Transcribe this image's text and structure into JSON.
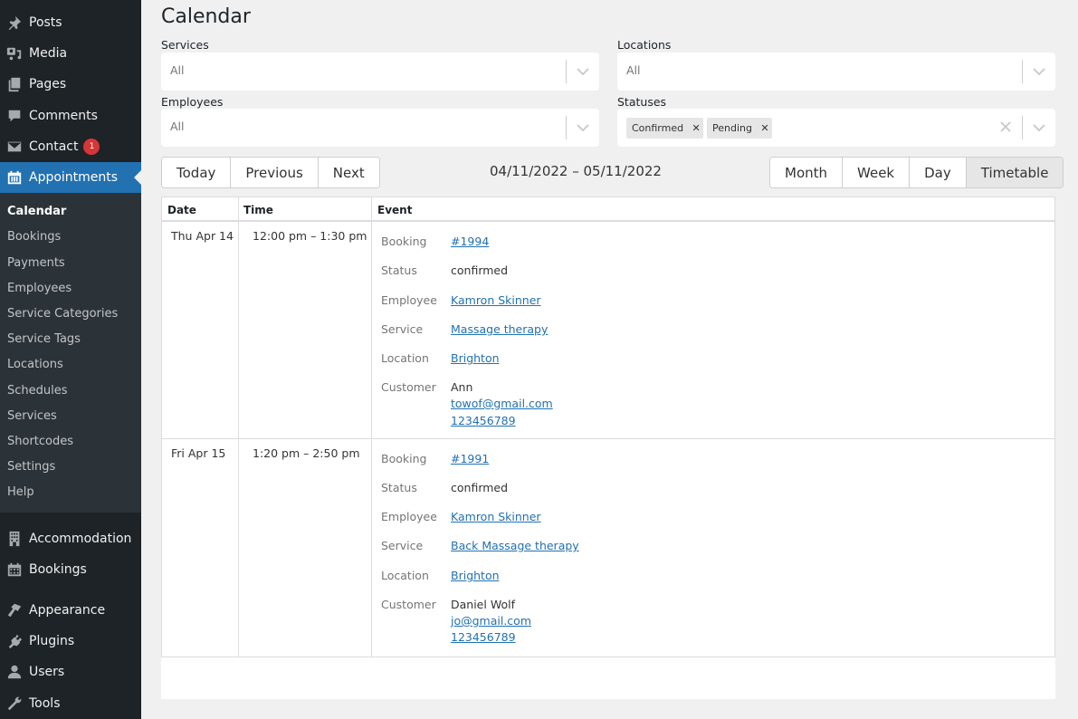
{
  "sidebar": {
    "top_items": [
      {
        "label": "Posts",
        "icon": "pin-icon"
      },
      {
        "label": "Media",
        "icon": "media-icon"
      },
      {
        "label": "Pages",
        "icon": "pages-icon"
      },
      {
        "label": "Comments",
        "icon": "comment-icon"
      },
      {
        "label": "Contact",
        "icon": "envelope-icon",
        "badge": "1"
      },
      {
        "label": "Appointments",
        "icon": "calendar-icon",
        "active": true
      }
    ],
    "submenu": [
      "Calendar",
      "Bookings",
      "Payments",
      "Employees",
      "Service Categories",
      "Service Tags",
      "Locations",
      "Schedules",
      "Services",
      "Shortcodes",
      "Settings",
      "Help"
    ],
    "submenu_current": "Calendar",
    "bottom_items": [
      {
        "label": "Accommodation",
        "icon": "building-icon"
      },
      {
        "label": "Bookings",
        "icon": "calendar-grid-icon"
      },
      {
        "label": "Appearance",
        "icon": "brush-icon"
      },
      {
        "label": "Plugins",
        "icon": "plug-icon"
      },
      {
        "label": "Users",
        "icon": "user-icon"
      },
      {
        "label": "Tools",
        "icon": "wrench-icon"
      }
    ]
  },
  "page": {
    "title": "Calendar"
  },
  "filters": {
    "services": {
      "label": "Services",
      "value": "All"
    },
    "locations": {
      "label": "Locations",
      "value": "All"
    },
    "employees": {
      "label": "Employees",
      "value": "All"
    },
    "statuses": {
      "label": "Statuses",
      "tags": [
        "Confirmed",
        "Pending"
      ]
    }
  },
  "toolbar": {
    "nav": [
      "Today",
      "Previous",
      "Next"
    ],
    "date_range": "04/11/2022 – 05/11/2022",
    "views": [
      "Month",
      "Week",
      "Day",
      "Timetable"
    ],
    "active_view": "Timetable"
  },
  "table": {
    "headers": [
      "Date",
      "Time",
      "Event"
    ],
    "field_labels": {
      "booking": "Booking",
      "status": "Status",
      "employee": "Employee",
      "service": "Service",
      "location": "Location",
      "customer": "Customer"
    },
    "rows": [
      {
        "date": "Thu Apr 14",
        "time": "12:00 pm – 1:30 pm",
        "booking": "#1994",
        "status": "confirmed",
        "employee": "Kamron Skinner",
        "service": "Massage therapy",
        "location": "Brighton",
        "customer_name": "Ann",
        "customer_email": "towof@gmail.com",
        "customer_phone": "123456789"
      },
      {
        "date": "Fri Apr 15",
        "time": "1:20 pm – 2:50 pm",
        "booking": "#1991",
        "status": "confirmed",
        "employee": "Kamron Skinner",
        "service": "Back Massage therapy",
        "location": "Brighton",
        "customer_name": "Daniel Wolf",
        "customer_email": "jo@gmail.com",
        "customer_phone": "123456789"
      }
    ]
  },
  "colors": {
    "sidebar_bg": "#1d2327",
    "submenu_bg": "#2c3338",
    "accent": "#2271b1",
    "badge": "#d63638",
    "link": "#2271b1"
  }
}
